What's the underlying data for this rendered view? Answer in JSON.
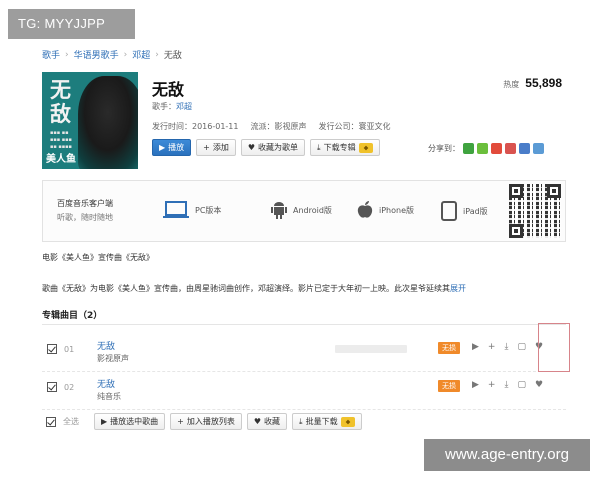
{
  "watermarks": {
    "top_left": "TG: MYYJJPP",
    "bottom_right": "www.age-entry.org"
  },
  "breadcrumb": [
    "歌手",
    "华语男歌手",
    "邓超",
    "无敌"
  ],
  "album": {
    "cover_big": "无\n敌",
    "cover_logo": "美人鱼",
    "title": "无敌",
    "hot_label": "热度",
    "hot_value": "55,898",
    "singer_label": "歌手：",
    "singer": "邓超",
    "release_date": "发行时间：2016-01-11",
    "genre": "流派：影视原声",
    "company": "发行公司：寰亚文化"
  },
  "actions": {
    "play": "播放",
    "add": "添加",
    "favorite": "收藏为歌单",
    "download": "下载专辑"
  },
  "share_label": "分享到：",
  "client": {
    "line1": "百度音乐客户端",
    "line2": "听歌，随时随地",
    "platforms": [
      "PC版本",
      "Android版",
      "iPhone版",
      "iPad版"
    ]
  },
  "intro": {
    "line1": "电影《美人鱼》宣传曲《无敌》",
    "line2": "歌曲《无敌》为电影《美人鱼》宣传曲，由周星驰词曲创作，邓超演绎。影片已定于大年初一上映。此次星爷延续其",
    "more": "展开"
  },
  "section": {
    "title": "专辑曲目",
    "count": "（2）"
  },
  "tracks": [
    {
      "no": "01",
      "name": "无敌",
      "sub": "影视原声",
      "badge": "无损"
    },
    {
      "no": "02",
      "name": "无敌",
      "sub": "纯音乐",
      "badge": "无损"
    }
  ],
  "footer": {
    "select_all": "全选",
    "play_selected": "播放选中歌曲",
    "add_to_list": "加入播放列表",
    "favorite": "收藏",
    "batch_download": "批量下载"
  },
  "colors": {
    "link": "#2f6fb6",
    "primary_button": "#2a71bd",
    "badge": "#f08a2a",
    "cover": "#1d7d7d"
  }
}
